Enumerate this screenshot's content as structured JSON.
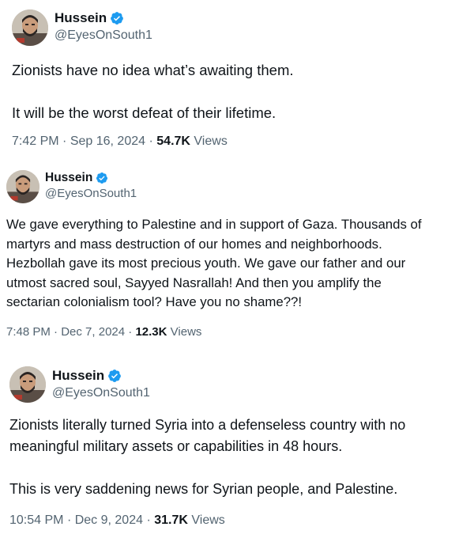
{
  "brand_colors": {
    "verified": "#1d9bf0",
    "text_primary": "#0f1419",
    "text_secondary": "#536471"
  },
  "tweets": [
    {
      "display_name": "Hussein",
      "handle": "@EyesOnSouth1",
      "verified_icon": "verified-badge-icon",
      "lines": [
        "Zionists have no idea what’s awaiting them.",
        "",
        "It will be the worst defeat of their lifetime."
      ],
      "time": "7:42 PM",
      "sep1": "·",
      "date": "Sep 16, 2024",
      "sep2": "·",
      "views_count": "54.7K",
      "views_label": "Views"
    },
    {
      "display_name": "Hussein",
      "handle": "@EyesOnSouth1",
      "verified_icon": "verified-badge-icon",
      "lines": [
        "We gave everything to Palestine and in support of Gaza. Thousands of",
        "martyrs and mass destruction of our homes and neighborhoods.",
        "Hezbollah gave its most precious youth. We gave our father and our",
        "utmost sacred soul, Sayyed Nasrallah! And then you amplify the",
        "sectarian colonialism tool? Have you no shame??!"
      ],
      "time": "7:48 PM",
      "sep1": "·",
      "date": "Dec 7, 2024",
      "sep2": "·",
      "views_count": "12.3K",
      "views_label": "Views"
    },
    {
      "display_name": "Hussein",
      "handle": "@EyesOnSouth1",
      "verified_icon": "verified-badge-icon",
      "lines": [
        "Zionists literally turned Syria into a defenseless country with no",
        "meaningful military assets or capabilities in 48 hours.",
        "",
        "This is very saddening news for Syrian people, and Palestine."
      ],
      "time": "10:54 PM",
      "sep1": "·",
      "date": "Dec 9, 2024",
      "sep2": "·",
      "views_count": "31.7K",
      "views_label": "Views"
    }
  ]
}
